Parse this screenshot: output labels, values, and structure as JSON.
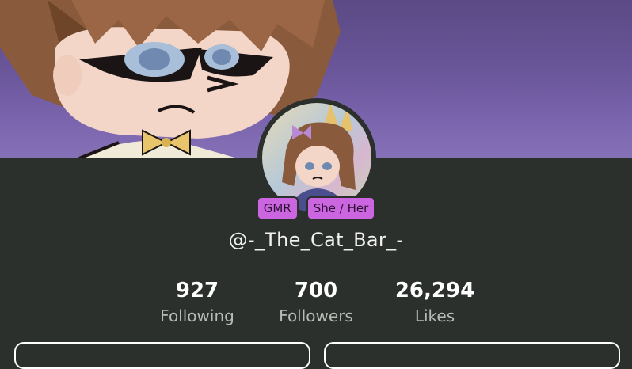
{
  "profile": {
    "badges": [
      "GMR",
      "She / Her"
    ],
    "username": "@-_The_Cat_Bar_-",
    "stats": [
      {
        "value": "927",
        "label": "Following"
      },
      {
        "value": "700",
        "label": "Followers"
      },
      {
        "value": "26,294",
        "label": "Likes"
      }
    ]
  },
  "colors": {
    "badge": "#cc66e0",
    "background": "#2b302c",
    "banner": "#6a569a"
  },
  "icons": {
    "banner": "character-banner-image",
    "avatar": "character-avatar-image"
  }
}
